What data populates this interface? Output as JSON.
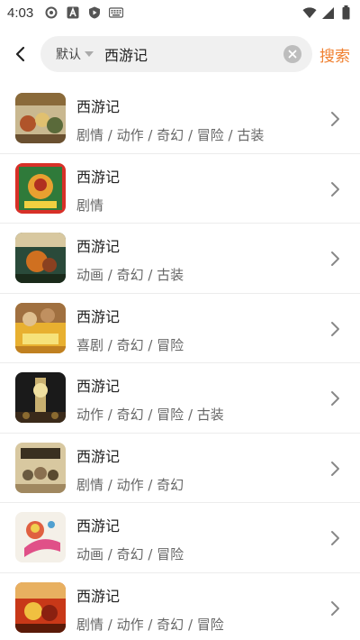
{
  "status": {
    "time": "4:03",
    "icons_left": [
      "gear-notification-icon",
      "a-notification-icon",
      "shield-play-icon",
      "keyboard-icon"
    ],
    "icons_right": [
      "wifi-icon",
      "signal-icon",
      "battery-icon"
    ]
  },
  "search": {
    "filter_label": "默认",
    "query": "西游记",
    "search_button": "搜索"
  },
  "results": [
    {
      "title": "西游记",
      "genres": "剧情 / 动作 / 奇幻 / 冒险 / 古装"
    },
    {
      "title": "西游记",
      "genres": "剧情"
    },
    {
      "title": "西游记",
      "genres": "动画 / 奇幻 / 古装"
    },
    {
      "title": "西游记",
      "genres": "喜剧 / 奇幻 / 冒险"
    },
    {
      "title": "西游记",
      "genres": "动作 / 奇幻 / 冒险 / 古装"
    },
    {
      "title": "西游记",
      "genres": "剧情 / 动作 / 奇幻"
    },
    {
      "title": "西游记",
      "genres": "动画 / 奇幻 / 冒险"
    },
    {
      "title": "西游记",
      "genres": "剧情 / 动作 / 奇幻 / 冒险"
    }
  ],
  "colors": {
    "accent": "#f08030",
    "search_box_bg": "#f0f0f0",
    "divider": "#ececec"
  }
}
